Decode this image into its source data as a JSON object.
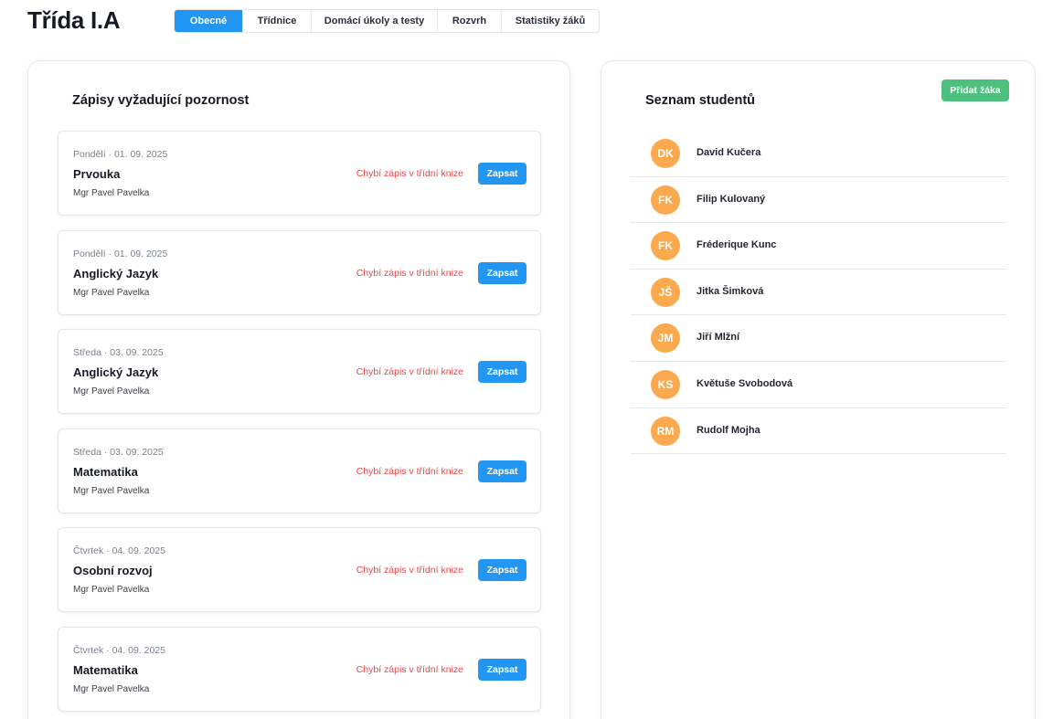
{
  "page_title": "Třída I.A",
  "tabs": [
    {
      "label": "Obecné",
      "active": true
    },
    {
      "label": "Třídnice",
      "active": false
    },
    {
      "label": "Domácí úkoly a testy",
      "active": false
    },
    {
      "label": "Rozvrh",
      "active": false
    },
    {
      "label": "Statistiky žáků",
      "active": false
    }
  ],
  "entries_panel": {
    "heading": "Zápisy vyžadující pozornost",
    "entries": [
      {
        "date": "Pondělí · 01. 09. 2025",
        "subject": "Prvouka",
        "teacher": "Mgr Pavel Pavelka",
        "warning": "Chybí zápis v třídní knize",
        "button": "Zapsat"
      },
      {
        "date": "Pondělí · 01. 09. 2025",
        "subject": "Anglický Jazyk",
        "teacher": "Mgr Pavel Pavelka",
        "warning": "Chybí zápis v třídní knize",
        "button": "Zapsat"
      },
      {
        "date": "Středa · 03. 09. 2025",
        "subject": "Anglický Jazyk",
        "teacher": "Mgr Pavel Pavelka",
        "warning": "Chybí zápis v třídní knize",
        "button": "Zapsat"
      },
      {
        "date": "Středa · 03. 09. 2025",
        "subject": "Matematika",
        "teacher": "Mgr Pavel Pavelka",
        "warning": "Chybí zápis v třídní knize",
        "button": "Zapsat"
      },
      {
        "date": "Čtvrtek · 04. 09. 2025",
        "subject": "Osobní rozvoj",
        "teacher": "Mgr Pavel Pavelka",
        "warning": "Chybí zápis v třídní knize",
        "button": "Zapsat"
      },
      {
        "date": "Čtvrtek · 04. 09. 2025",
        "subject": "Matematika",
        "teacher": "Mgr Pavel Pavelka",
        "warning": "Chybí zápis v třídní knize",
        "button": "Zapsat"
      }
    ]
  },
  "students_panel": {
    "heading": "Seznam studentů",
    "add_button": "Přidat žáka",
    "students": [
      {
        "initials": "DK",
        "name": "David Kučera"
      },
      {
        "initials": "FK",
        "name": "Filip Kulovaný"
      },
      {
        "initials": "FK",
        "name": "Fréderique Kunc"
      },
      {
        "initials": "JŠ",
        "name": "Jitka Šimková"
      },
      {
        "initials": "JM",
        "name": "Jiří Mlžní"
      },
      {
        "initials": "KS",
        "name": "Květuše Svobodová"
      },
      {
        "initials": "RM",
        "name": "Rudolf Mojha"
      }
    ]
  },
  "colors": {
    "primary": "#2196f3",
    "success": "#4cc07c",
    "warning_text": "#ef4444",
    "avatar": "#fba94f"
  }
}
